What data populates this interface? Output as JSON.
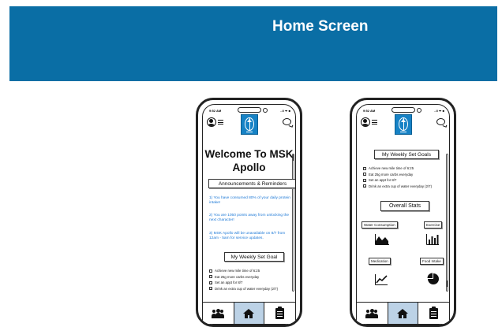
{
  "header": {
    "title": "Home Screen",
    "bg": "#0a6ea5"
  },
  "status_bar": {
    "time": "9:52 AM",
    "signal": "..ll ᯤ ■"
  },
  "left_phone": {
    "welcome": "Welcome To MSK Apollo",
    "announcements_title": "Announcements & Reminders",
    "announcements": [
      "1) You have consumed 80% of your daily protein intake!",
      "2) You are 1050 points away from unlocking the next character!",
      "3) MSK Apollo will be unavailable on 8/7 from 12am - 5am for service updates."
    ],
    "goals_title": "My Weekly Set Goal",
    "goals": [
      {
        "text": "Achieve new mile time of 6:25",
        "checked": false
      },
      {
        "text": "Eat 25g more carbs everyday",
        "checked": false
      },
      {
        "text": "Set an appt for 8/7",
        "checked": true
      },
      {
        "text": "Drink an extra cup of water everyday (2/7)",
        "checked": true
      }
    ]
  },
  "right_phone": {
    "goals_title": "My Weekly Set Goals",
    "goals": [
      {
        "text": "Achieve new mile time of 6:25",
        "checked": false
      },
      {
        "text": "Eat 25g more carbs everyday",
        "checked": false
      },
      {
        "text": "Set an appt for 8/7",
        "checked": true
      },
      {
        "text": "Drink an extra cup of water everyday (2/7)",
        "checked": true
      }
    ],
    "stats_title": "Overall Stats",
    "stats": [
      {
        "label": "Water Consumption",
        "icon": "area-chart-icon"
      },
      {
        "label": "Exercise",
        "icon": "bar-chart-icon"
      },
      {
        "label": "Medication",
        "icon": "line-chart-icon"
      },
      {
        "label": "Food Intake",
        "icon": "pie-chart-icon"
      }
    ]
  },
  "tabbar": {
    "items": [
      "people-icon",
      "home-icon",
      "clipboard-icon"
    ],
    "active": "home-icon",
    "active_bg": "#bcd2e6"
  },
  "colors": {
    "announcement_text": "#1c78d6",
    "logo_bg": "#1682c5"
  }
}
